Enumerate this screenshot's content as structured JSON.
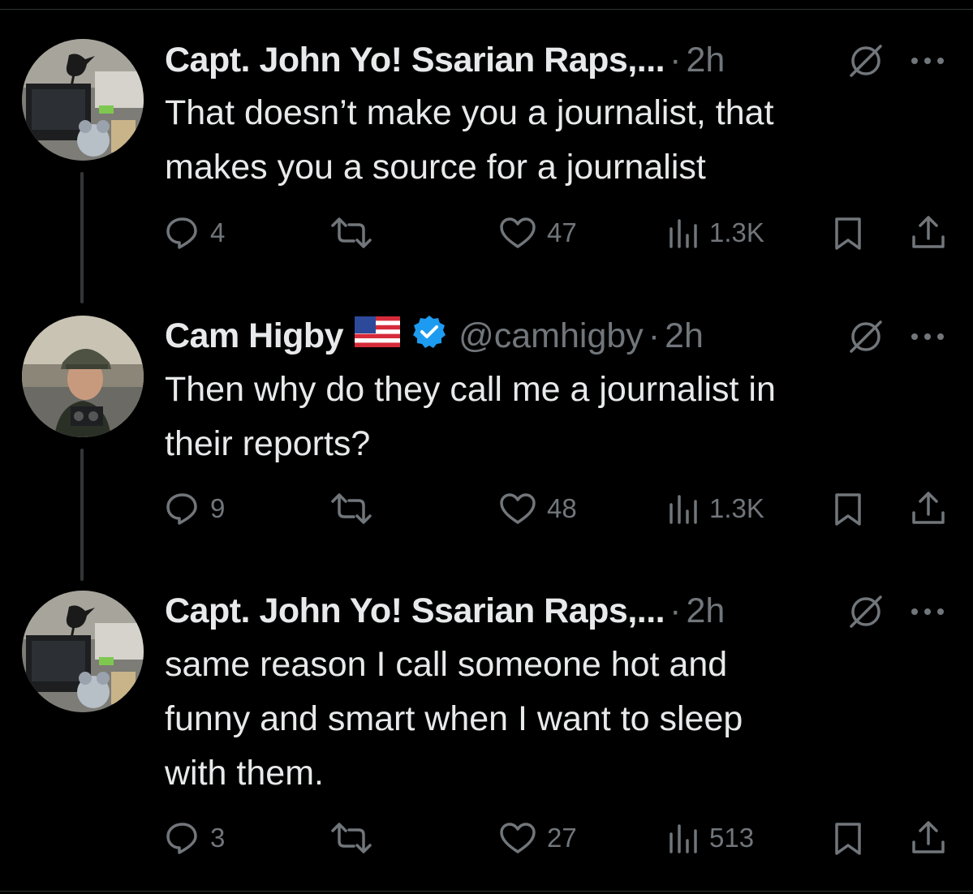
{
  "tweets": [
    {
      "name": "Capt. John Yo! Ssarian Raps,...",
      "handle": "",
      "time": "2h",
      "text": "That doesn’t make you a journalist, that\nmakes you a source for a journalist",
      "replies": "4",
      "likes": "47",
      "views": "1.3K"
    },
    {
      "name": "Cam Higby",
      "handle": "@camhigby",
      "time": "2h",
      "text": "Then why do they call me a journalist in\ntheir reports?",
      "replies": "9",
      "likes": "48",
      "views": "1.3K"
    },
    {
      "name": "Capt. John Yo! Ssarian Raps,...",
      "handle": "",
      "time": "2h",
      "text": "same reason I call someone hot and\nfunny and smart when I want to sleep\nwith them.",
      "replies": "3",
      "likes": "27",
      "views": "513"
    }
  ],
  "sep": "·",
  "icons": {
    "reply": "reply-icon",
    "retweet": "retweet-icon",
    "like": "heart-icon",
    "views": "views-icon",
    "bookmark": "bookmark-icon",
    "share": "share-icon",
    "grok": "grok-icon",
    "more": "more-icon",
    "verified": "verified-badge-icon",
    "flag": "us-flag-icon"
  },
  "colors": {
    "background": "#000000",
    "text": "#e7e9ea",
    "muted": "#71767b",
    "verified": "#1d9bf0"
  }
}
